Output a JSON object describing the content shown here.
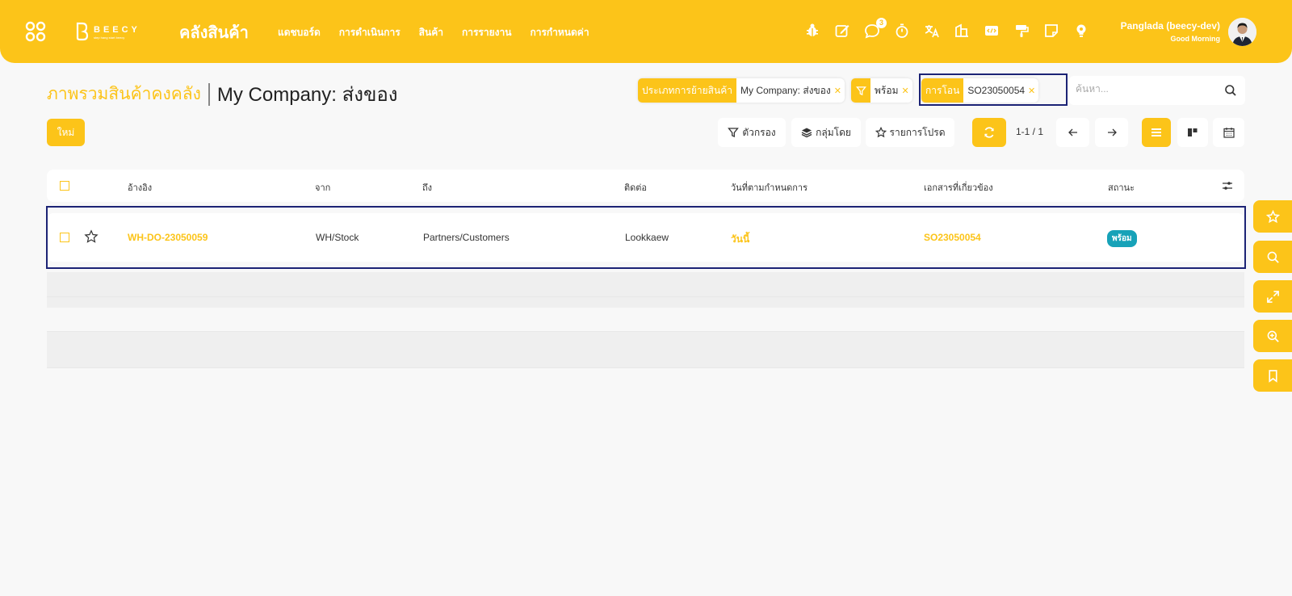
{
  "app": {
    "brand": "BEECY",
    "brand_tagline": "step hang start beecy",
    "title": "คลังสินค้า"
  },
  "nav": [
    {
      "label": "แดชบอร์ด"
    },
    {
      "label": "การดำเนินการ"
    },
    {
      "label": "สินค้า"
    },
    {
      "label": "การรายงาน"
    },
    {
      "label": "การกำหนดค่า"
    }
  ],
  "systray": {
    "icons": [
      "bug-icon",
      "edit-icon",
      "chat-icon",
      "timer-icon",
      "translate-icon",
      "company-icon",
      "code-icon",
      "paint-icon",
      "note-icon",
      "lightbulb-icon"
    ],
    "chat_badge": "3"
  },
  "user": {
    "name": "Panglada (beecy-dev)",
    "greeting": "Good Morning"
  },
  "breadcrumb": {
    "parent": "ภาพรวมสินค้าคงคลัง",
    "current": "My Company: ส่งของ"
  },
  "search": {
    "facets": [
      {
        "label": "ประเภทการย้ายสินค้า",
        "value": "My Company: ส่งของ"
      },
      {
        "label": "",
        "icon": "filter-icon",
        "value": "พร้อม"
      },
      {
        "label": "การโอน",
        "value": "SO23050054"
      }
    ],
    "placeholder": "ค้นหา..."
  },
  "controls": {
    "new_label": "ใหม่",
    "filter_label": "ตัวกรอง",
    "groupby_label": "กลุ่มโดย",
    "favorites_label": "รายการโปรด",
    "pager": "1-1 / 1"
  },
  "table": {
    "columns": [
      "อ้างอิง",
      "จาก",
      "ถึง",
      "ติดต่อ",
      "วันที่ตามกำหนดการ",
      "เอกสารที่เกี่ยวข้อง",
      "สถานะ"
    ],
    "rows": [
      {
        "reference": "WH-DO-23050059",
        "from": "WH/Stock",
        "to": "Partners/Customers",
        "contact": "Lookkaew",
        "scheduled": "วันนี้",
        "source": "SO23050054",
        "status": "พร้อม"
      }
    ]
  },
  "colors": {
    "accent": "#fcc419",
    "highlight_border": "#1c2375",
    "status_ready": "#17a2b8"
  },
  "side_buttons": [
    "star-icon",
    "search-icon",
    "expand-icon",
    "zoom-in-icon",
    "bookmark-icon"
  ]
}
